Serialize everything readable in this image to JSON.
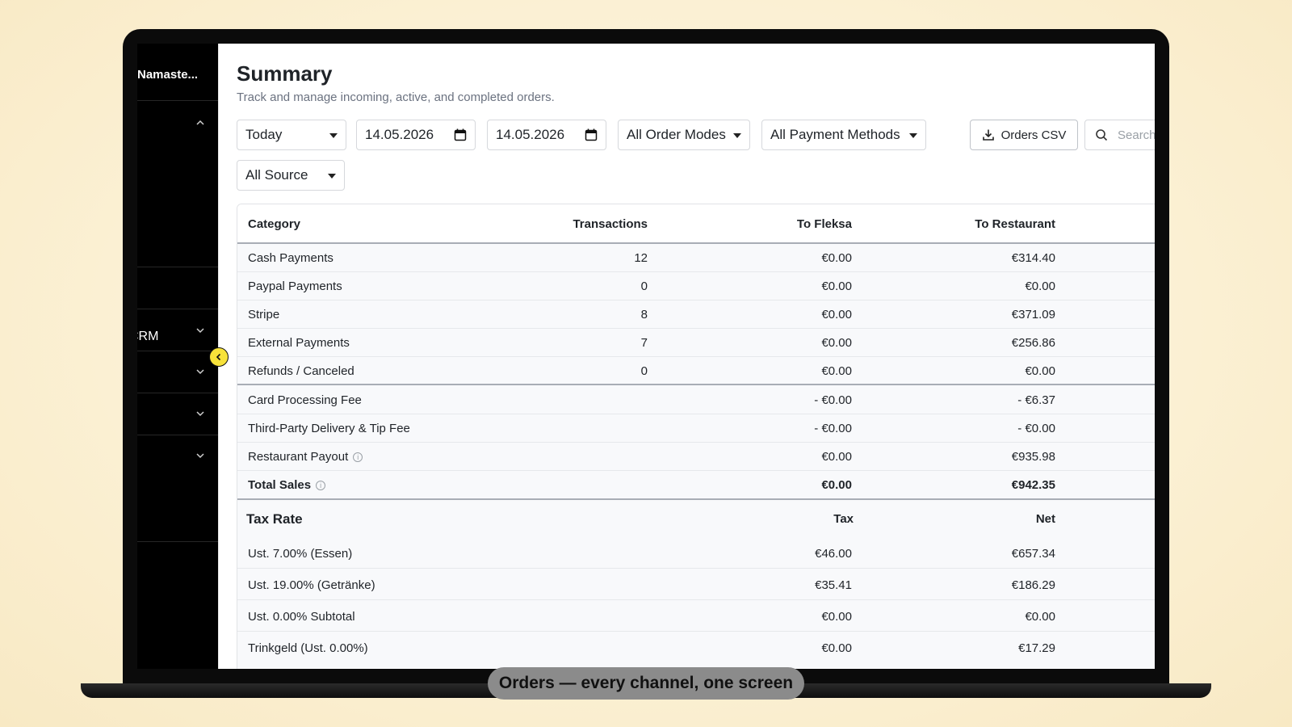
{
  "sidebar": {
    "brand": "Namaste...",
    "crm_label": "CRM"
  },
  "header": {
    "title": "Summary",
    "subtitle": "Track and manage incoming, active, and completed orders."
  },
  "filters": {
    "period": "Today",
    "date_from": "14.05.2026",
    "date_to": "14.05.2026",
    "order_modes": "All Order Modes",
    "payment_methods": "All Payment Methods",
    "source": "All Source",
    "csv_button": "Orders CSV",
    "search_placeholder": "Search"
  },
  "table": {
    "headers": [
      "Category",
      "Transactions",
      "To Fleksa",
      "To Restaurant"
    ],
    "payments": [
      {
        "category": "Cash Payments",
        "transactions": "12",
        "to_fleksa": "€0.00",
        "to_restaurant": "€314.40"
      },
      {
        "category": "Paypal Payments",
        "transactions": "0",
        "to_fleksa": "€0.00",
        "to_restaurant": "€0.00"
      },
      {
        "category": "Stripe",
        "transactions": "8",
        "to_fleksa": "€0.00",
        "to_restaurant": "€371.09"
      },
      {
        "category": "External Payments",
        "transactions": "7",
        "to_fleksa": "€0.00",
        "to_restaurant": "€256.86"
      },
      {
        "category": "Refunds / Canceled",
        "transactions": "0",
        "to_fleksa": "€0.00",
        "to_restaurant": "€0.00"
      }
    ],
    "fees": [
      {
        "category": "Card Processing Fee",
        "to_fleksa": "- €0.00",
        "to_restaurant": "- €6.37"
      },
      {
        "category": "Third-Party Delivery & Tip Fee",
        "to_fleksa": "- €0.00",
        "to_restaurant": "- €0.00"
      },
      {
        "category": "Restaurant Payout",
        "to_fleksa": "€0.00",
        "to_restaurant": "€935.98"
      },
      {
        "category": "Total Sales",
        "to_fleksa": "€0.00",
        "to_restaurant": "€942.35"
      }
    ],
    "tax_headers": [
      "Tax Rate",
      "Tax",
      "Net"
    ],
    "taxes": [
      {
        "rate": "Ust. 7.00% (Essen)",
        "tax": "€46.00",
        "net": "€657.34"
      },
      {
        "rate": "Ust. 19.00% (Getränke)",
        "tax": "€35.41",
        "net": "€186.29"
      },
      {
        "rate": "Ust. 0.00% Subtotal",
        "tax": "€0.00",
        "net": "€0.00"
      },
      {
        "rate": "Trinkgeld (Ust. 0.00%)",
        "tax": "€0.00",
        "net": "€17.29"
      }
    ]
  },
  "caption": "Orders — every channel, one screen",
  "info_glyph": "i",
  "colors": {
    "accent_yellow": "#f7e23a",
    "sidebar_bg": "#000000",
    "table_bg": "#f8f9fb"
  }
}
